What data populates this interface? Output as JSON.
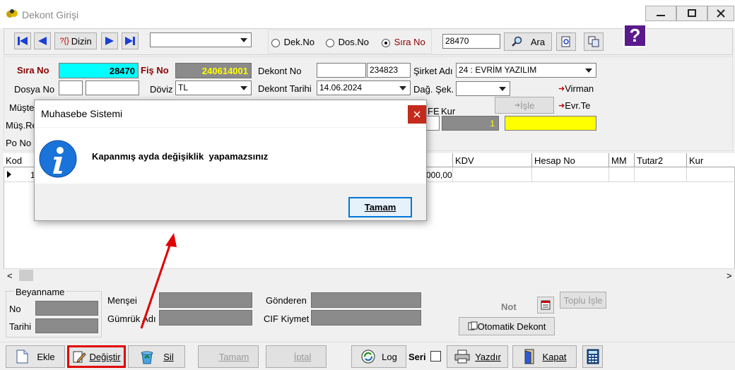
{
  "window": {
    "title": "Dekont Girişi"
  },
  "toolbar": {
    "dizin_label": "Dizin",
    "radio_dekno": "Dek.No",
    "radio_dosno": "Dos.No",
    "radio_sirano": "Sıra No",
    "search_value": "28470",
    "ara_label": "Ara"
  },
  "form": {
    "sira_no_label": "Sıra No",
    "sira_no_value": "28470",
    "fis_no_label": "Fiş No",
    "fis_no_value": "240614001",
    "dekont_no_label": "Dekont No",
    "dekont_no_value": "234823",
    "sirket_adi_label": "Şirket Adı",
    "sirket_adi_value": "24 : EVRİM YAZILIM",
    "dosya_no_label": "Dosya No",
    "doviz_label": "Döviz",
    "doviz_value": "TL",
    "dekont_tarihi_label": "Dekont Tarihi",
    "dekont_tarihi_value": "14.06.2024",
    "dag_sek_label": "Dağ. Şek.",
    "virman_label": "Virman",
    "musteri_label": "Müşte",
    "isle_label": "İşle",
    "evr_te_label": "Evr.Te",
    "mus_re_label": "Müş.Re",
    "fe_label": "FE",
    "kur_label": "Kur",
    "kur_value": "1",
    "po_no_label": "Po No"
  },
  "grid": {
    "headers_left": [
      "Kod"
    ],
    "headers_right": [
      "KDV",
      "Hesap No",
      "MM",
      "Tutar2",
      "Kur"
    ],
    "row_left": "1",
    "row_amount": "000,00"
  },
  "beyanname": {
    "title": "Beyanname",
    "no_label": "No",
    "tarihi_label": "Tarihi",
    "mensei_label": "Menşei",
    "gumruk_label": "Gümrük Adı",
    "gonderen_label": "Gönderen",
    "cif_label": "CIF Kiymet",
    "not_label": "Not",
    "toplu_label": "Toplu İşle",
    "otomatik_label": "Otomatik Dekont"
  },
  "bottom": {
    "ekle": "Ekle",
    "degistir": "Değiştir",
    "sil": "Sil",
    "tamam": "Tamam",
    "iptal": "İptal",
    "log": "Log",
    "seri": "Seri",
    "yazdir": "Yazdır",
    "kapat": "Kapat"
  },
  "dialog": {
    "title": "Muhasebe Sistemi",
    "message": "Kapanmış ayda değişiklik  yapamazsınız",
    "ok_label": "Tamam"
  },
  "colors": {
    "highlight_red": "#e00000",
    "cyan": "#00ffff",
    "yellow": "#ffff00"
  }
}
